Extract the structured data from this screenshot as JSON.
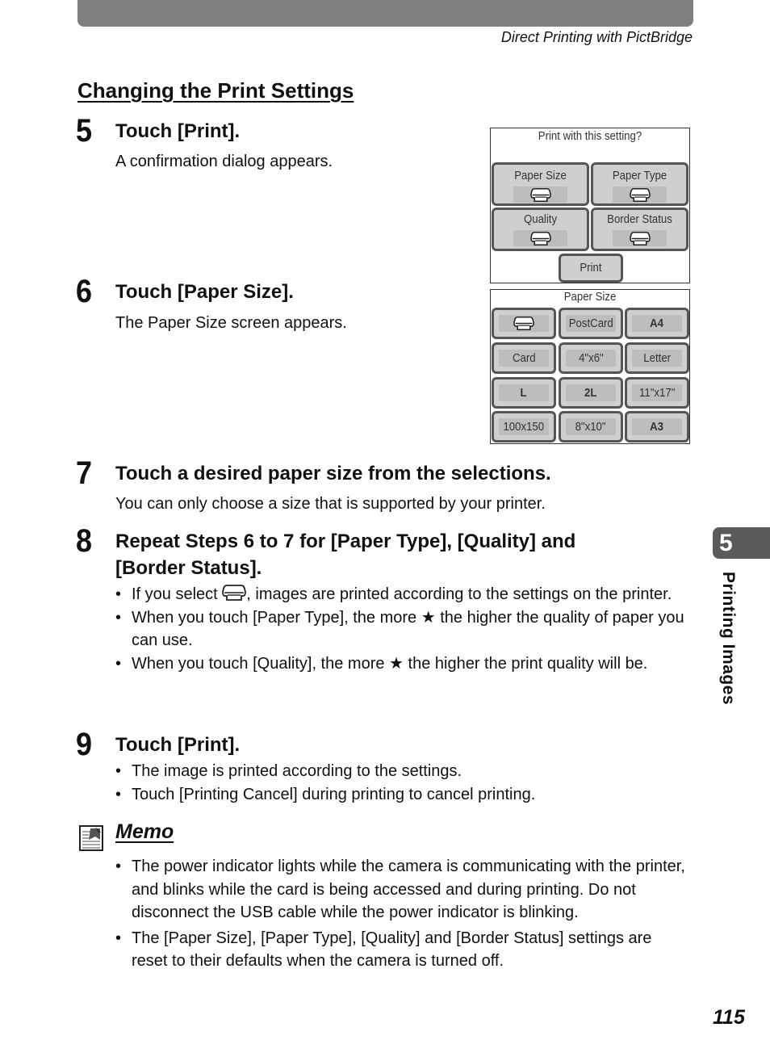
{
  "header": {
    "running_head": "Direct Printing with PictBridge"
  },
  "section": {
    "title": "Changing the Print Settings"
  },
  "steps": [
    {
      "number": "5",
      "title": "Touch [Print].",
      "body": "A confirmation dialog appears."
    },
    {
      "number": "6",
      "title": "Touch [Paper Size].",
      "body": "The Paper Size screen appears."
    },
    {
      "number": "7",
      "title": "Touch a desired paper size from the selections.",
      "body": "You can only choose a size that is supported by your printer."
    },
    {
      "number": "8",
      "title": "Repeat Steps 6 to 7 for [Paper Type], [Quality] and [Border Status].",
      "bullets": [
        {
          "before_icon": "If you select ",
          "icon": "printer-icon",
          "after_icon": ", images are printed according to the settings on the printer."
        },
        {
          "text": "When you touch [Paper Type], the more ★ the higher the quality of paper you can use."
        },
        {
          "text": "When you touch [Quality], the more ★ the higher the print quality will be."
        }
      ]
    },
    {
      "number": "9",
      "title": "Touch [Print].",
      "bullets": [
        {
          "text": "The image is printed according to the settings."
        },
        {
          "text": "Touch [Printing Cancel] during printing to cancel printing."
        }
      ]
    }
  ],
  "confirm_screen": {
    "title": "Print with this setting?",
    "buttons": [
      {
        "label": "Paper Size",
        "icon": "printer-icon"
      },
      {
        "label": "Paper Type",
        "icon": "printer-icon"
      },
      {
        "label": "Quality",
        "icon": "printer-icon"
      },
      {
        "label": "Border Status",
        "icon": "printer-icon"
      }
    ],
    "print_label": "Print"
  },
  "paper_size_screen": {
    "title": "Paper Size",
    "options": [
      {
        "label": "",
        "icon": "printer-icon",
        "bold": false
      },
      {
        "label": "PostCard",
        "bold": false
      },
      {
        "label": "A4",
        "bold": true
      },
      {
        "label": "Card",
        "bold": false
      },
      {
        "label": "4\"x6\"",
        "bold": false
      },
      {
        "label": "Letter",
        "bold": false
      },
      {
        "label": "L",
        "bold": true
      },
      {
        "label": "2L",
        "bold": true
      },
      {
        "label": "11\"x17\"",
        "bold": false
      },
      {
        "label": "100x150",
        "bold": false
      },
      {
        "label": "8\"x10\"",
        "bold": false
      },
      {
        "label": "A3",
        "bold": true
      }
    ]
  },
  "memo": {
    "title": "Memo",
    "items": [
      "The power indicator lights while the camera is communicating with the printer, and blinks while the card is being accessed and during printing. Do not disconnect the USB cable while the power indicator is blinking.",
      "The [Paper Size], [Paper Type], [Quality] and [Border Status] settings are reset to their defaults when the camera is turned off."
    ]
  },
  "chapter": {
    "number": "5",
    "label": "Printing Images"
  },
  "page_number": "115"
}
